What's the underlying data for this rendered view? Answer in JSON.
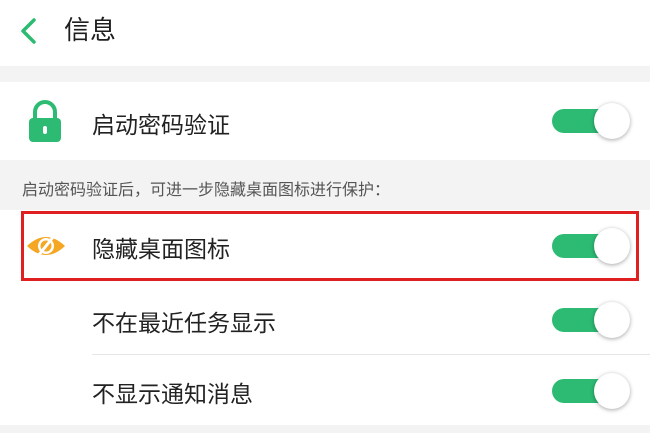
{
  "header": {
    "title": "信息",
    "back_icon": "chevron-left-icon"
  },
  "password_row": {
    "label": "启动密码验证",
    "icon": "lock-icon",
    "enabled": true
  },
  "section_note": "启动密码验证后，可进一步隐藏桌面图标进行保护：",
  "settings": [
    {
      "label": "隐藏桌面图标",
      "icon": "eye-off-icon",
      "enabled": true,
      "highlighted": true
    },
    {
      "label": "不在最近任务显示",
      "enabled": true
    },
    {
      "label": "不显示通知消息",
      "enabled": true
    }
  ],
  "colors": {
    "accent": "#2dbb73",
    "icon_orange": "#f5a623",
    "highlight": "#e02020"
  }
}
